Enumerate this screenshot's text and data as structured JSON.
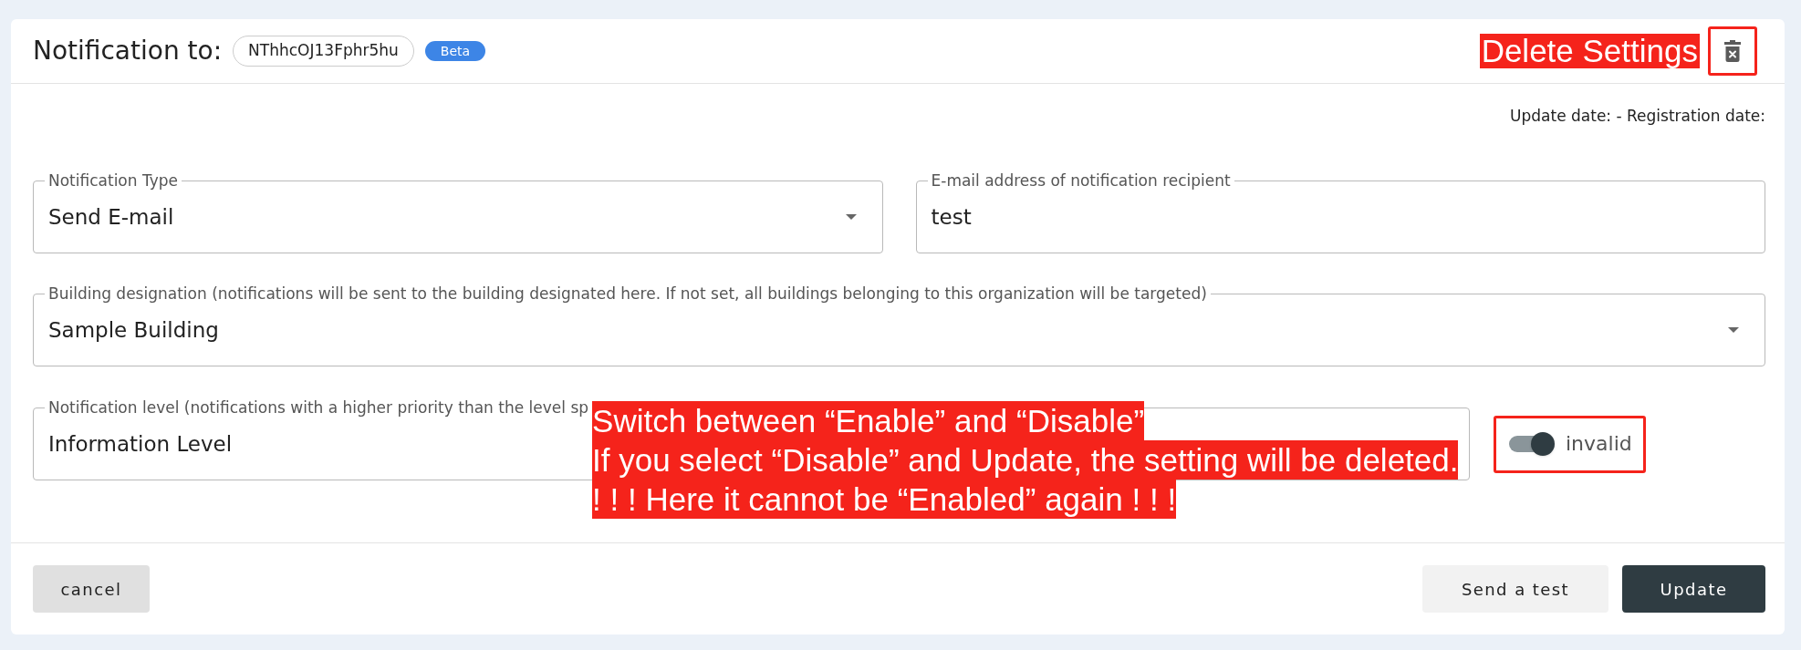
{
  "header": {
    "title": "Notification to:",
    "recipient_id": "NThhcOJ13Fphr5hu",
    "badge": "Beta",
    "delete_note": "Delete Settings"
  },
  "dates": "Update date: - Registration date:",
  "fields": [
    {
      "kind": "select",
      "label": "Notification Type",
      "value": "Send E-mail"
    },
    {
      "kind": "input",
      "label": "E-mail address of notification recipient",
      "value": "test"
    },
    {
      "kind": "select",
      "label": "Building designation (notifications will be sent to the building designated here. If not set, all buildings belonging to this organization will be targeted)",
      "value": "Sample Building"
    },
    {
      "kind": "input",
      "label": "Notification level (notifications with a higher priority than the level sp",
      "value": "Information Level"
    }
  ],
  "toggle": {
    "label": "invalid",
    "on": true
  },
  "note": {
    "lines": [
      "Switch between “Enable” and “Disable”",
      "If you select “Disable” and Update, the setting will be deleted.",
      "! ! ! Here it cannot be “Enabled” again ! ! !"
    ]
  },
  "buttons": [
    {
      "kind": "cancel",
      "label": "cancel"
    },
    {
      "kind": "secondary",
      "label": "Send a test"
    },
    {
      "kind": "primary",
      "label": "Update"
    }
  ]
}
